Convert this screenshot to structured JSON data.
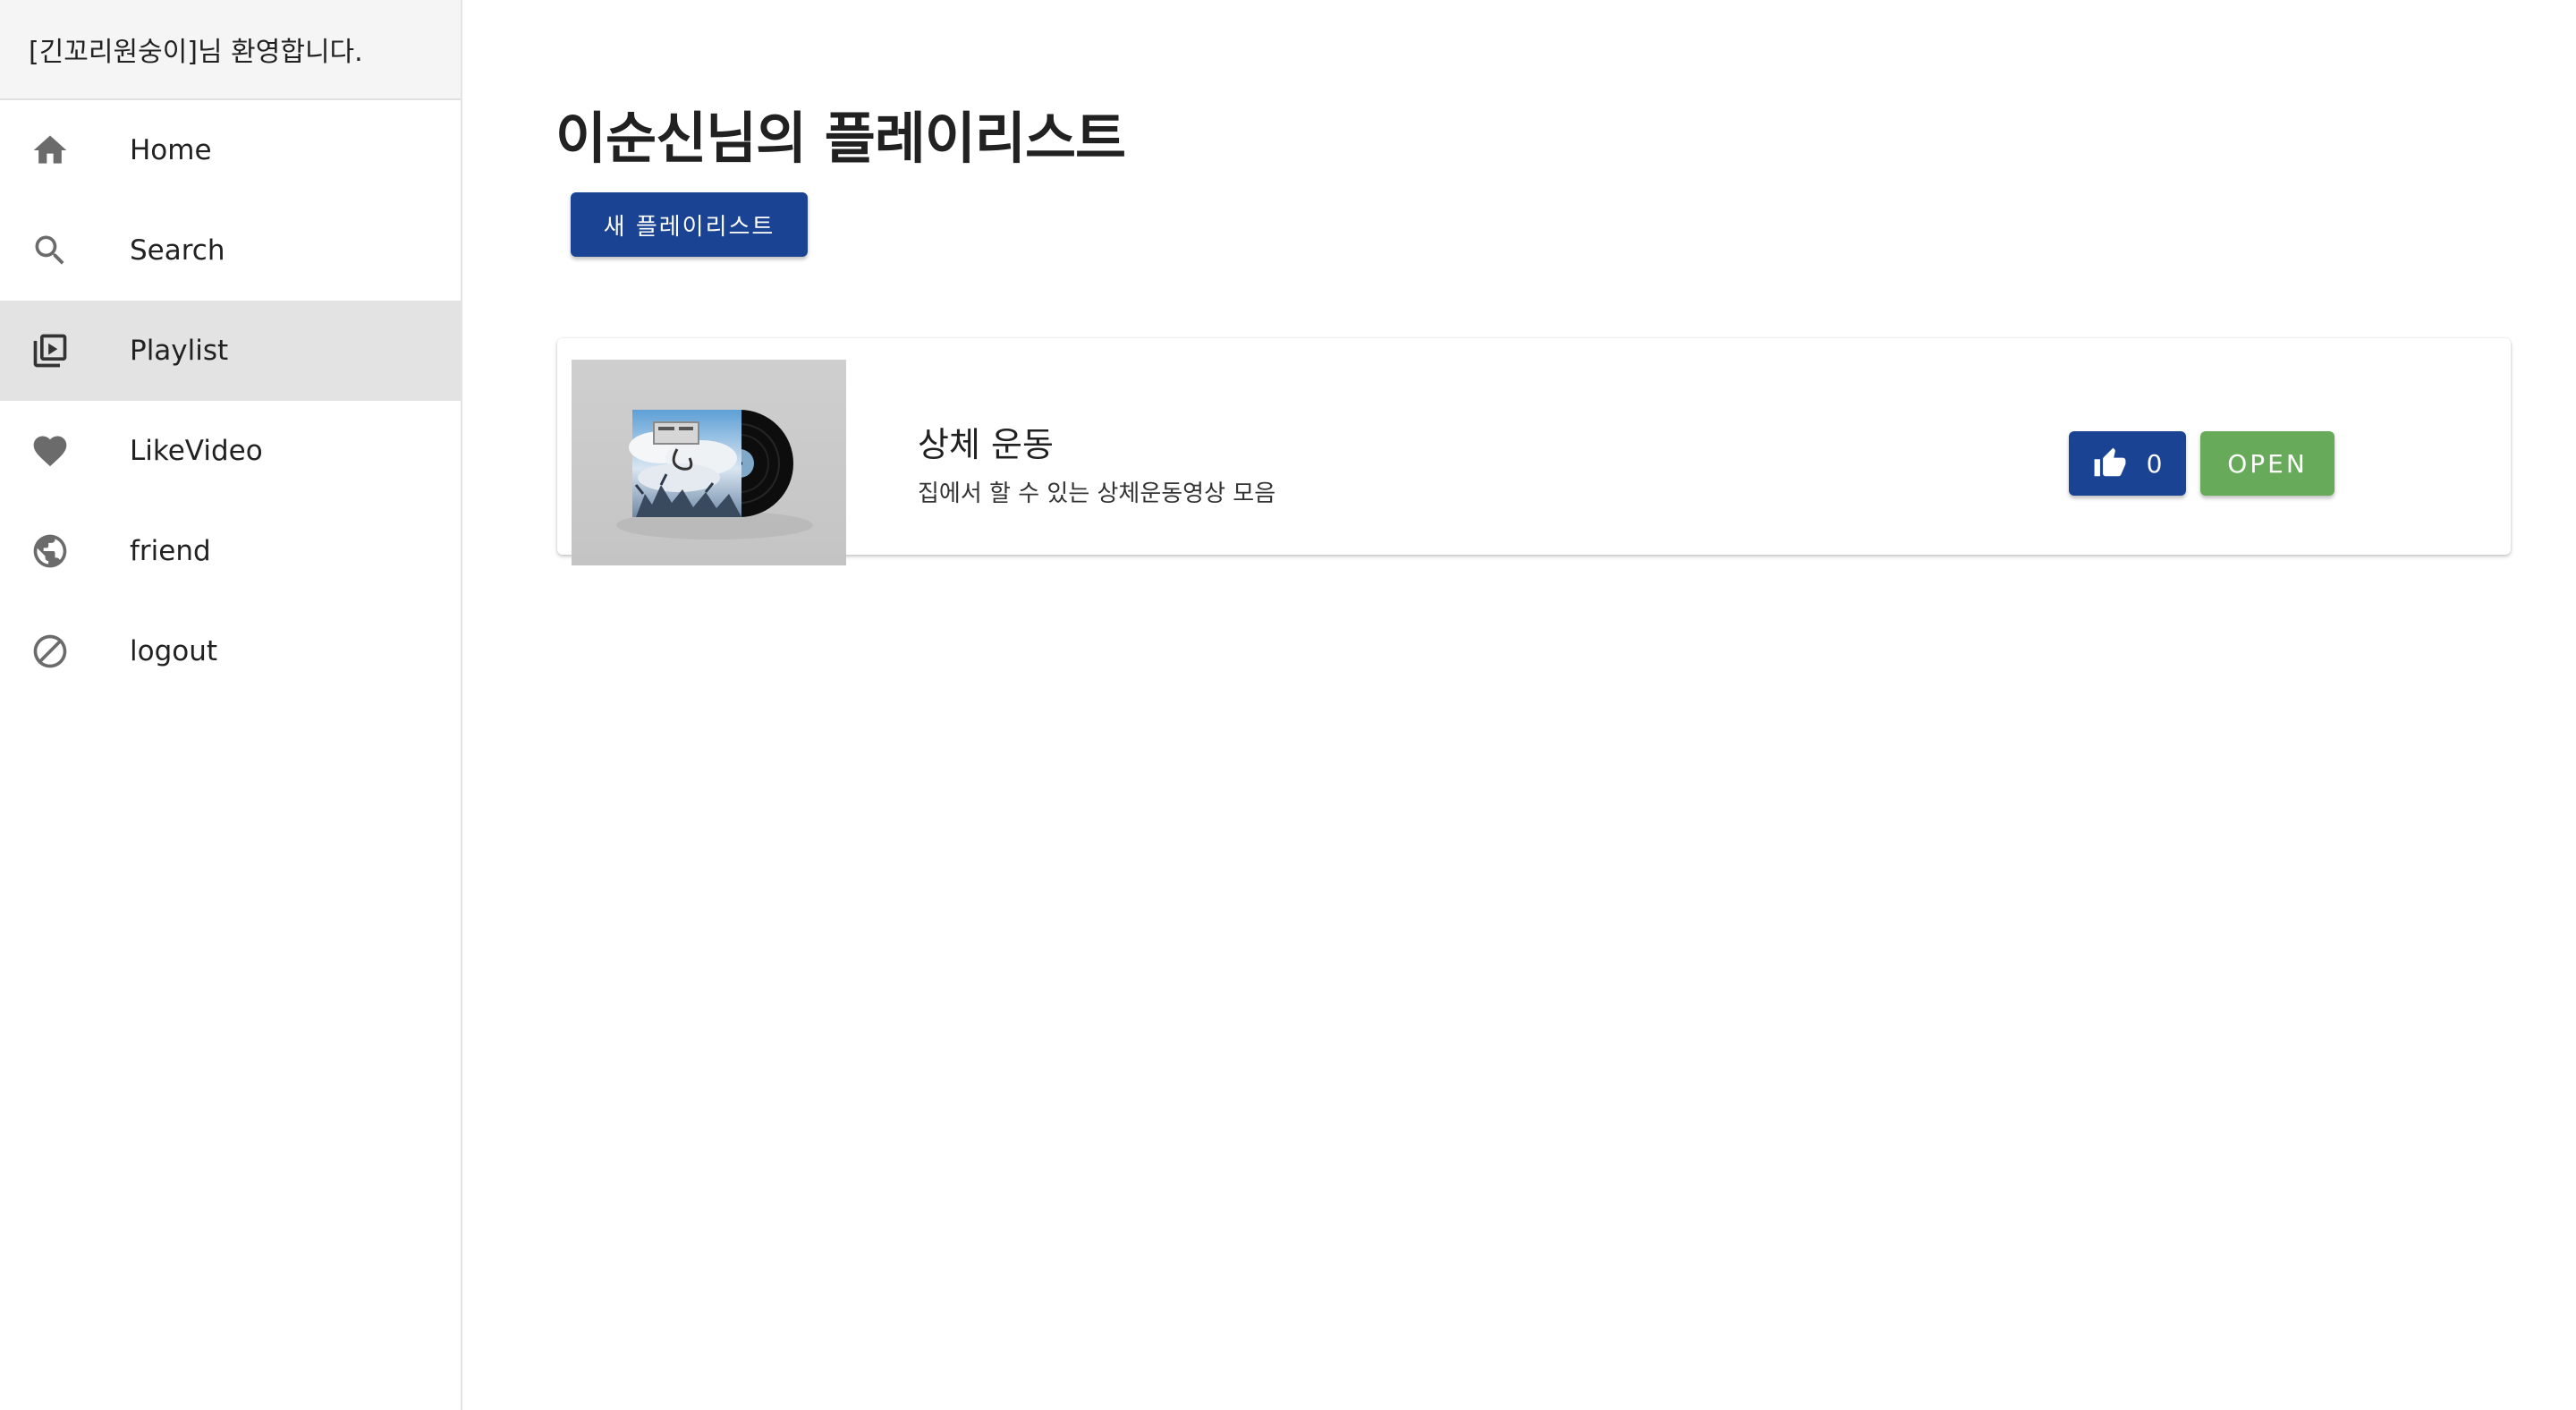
{
  "sidebar": {
    "welcome": "[긴꼬리원숭이]님 환영합니다.",
    "items": [
      {
        "label": "Home",
        "icon": "home-icon"
      },
      {
        "label": "Search",
        "icon": "search-icon"
      },
      {
        "label": "Playlist",
        "icon": "playlist-icon",
        "active": true
      },
      {
        "label": "LikeVideo",
        "icon": "heart-icon"
      },
      {
        "label": "friend",
        "icon": "globe-icon"
      },
      {
        "label": "logout",
        "icon": "block-icon"
      }
    ]
  },
  "main": {
    "title": "이순신님의 플레이리스트",
    "new_playlist_label": "새 플레이리스트",
    "playlists": [
      {
        "title": "상체 운동",
        "description": "집에서 할 수 있는 상체운동영상 모음",
        "likes": "0",
        "open_label": "OPEN",
        "thumbnail_icon": "vinyl-album-thumbnail"
      }
    ]
  },
  "colors": {
    "primary": "#1a4394",
    "open": "#66aa5a",
    "active_bg": "#e3e3e3",
    "header_bg": "#f5f5f5"
  }
}
